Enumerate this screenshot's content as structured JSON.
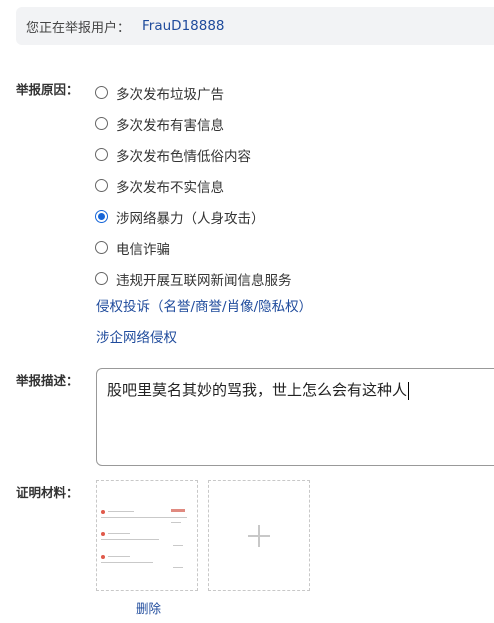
{
  "banner": {
    "prefix": "您正在举报用户：",
    "username": "FrauD18888"
  },
  "reason": {
    "label": "举报原因：",
    "options": [
      {
        "text": "多次发布垃圾广告",
        "checked": false
      },
      {
        "text": "多次发布有害信息",
        "checked": false
      },
      {
        "text": "多次发布色情低俗内容",
        "checked": false
      },
      {
        "text": "多次发布不实信息",
        "checked": false
      },
      {
        "text": "涉网络暴力（人身攻击）",
        "checked": true
      },
      {
        "text": "电信诈骗",
        "checked": false
      },
      {
        "text": "违规开展互联网新闻信息服务",
        "checked": false
      }
    ],
    "links": [
      "侵权投诉（名誉/商誉/肖像/隐私权）",
      "涉企网络侵权"
    ]
  },
  "description": {
    "label": "举报描述：",
    "value": "股吧里莫名其妙的骂我，世上怎么会有这种人"
  },
  "evidence": {
    "label": "证明材料：",
    "delete_label": "删除",
    "add_icon": "plus-icon"
  },
  "colors": {
    "link": "#1f4b9c",
    "radio_checked": "#1565d8",
    "banner_bg": "#f2f3f5"
  }
}
